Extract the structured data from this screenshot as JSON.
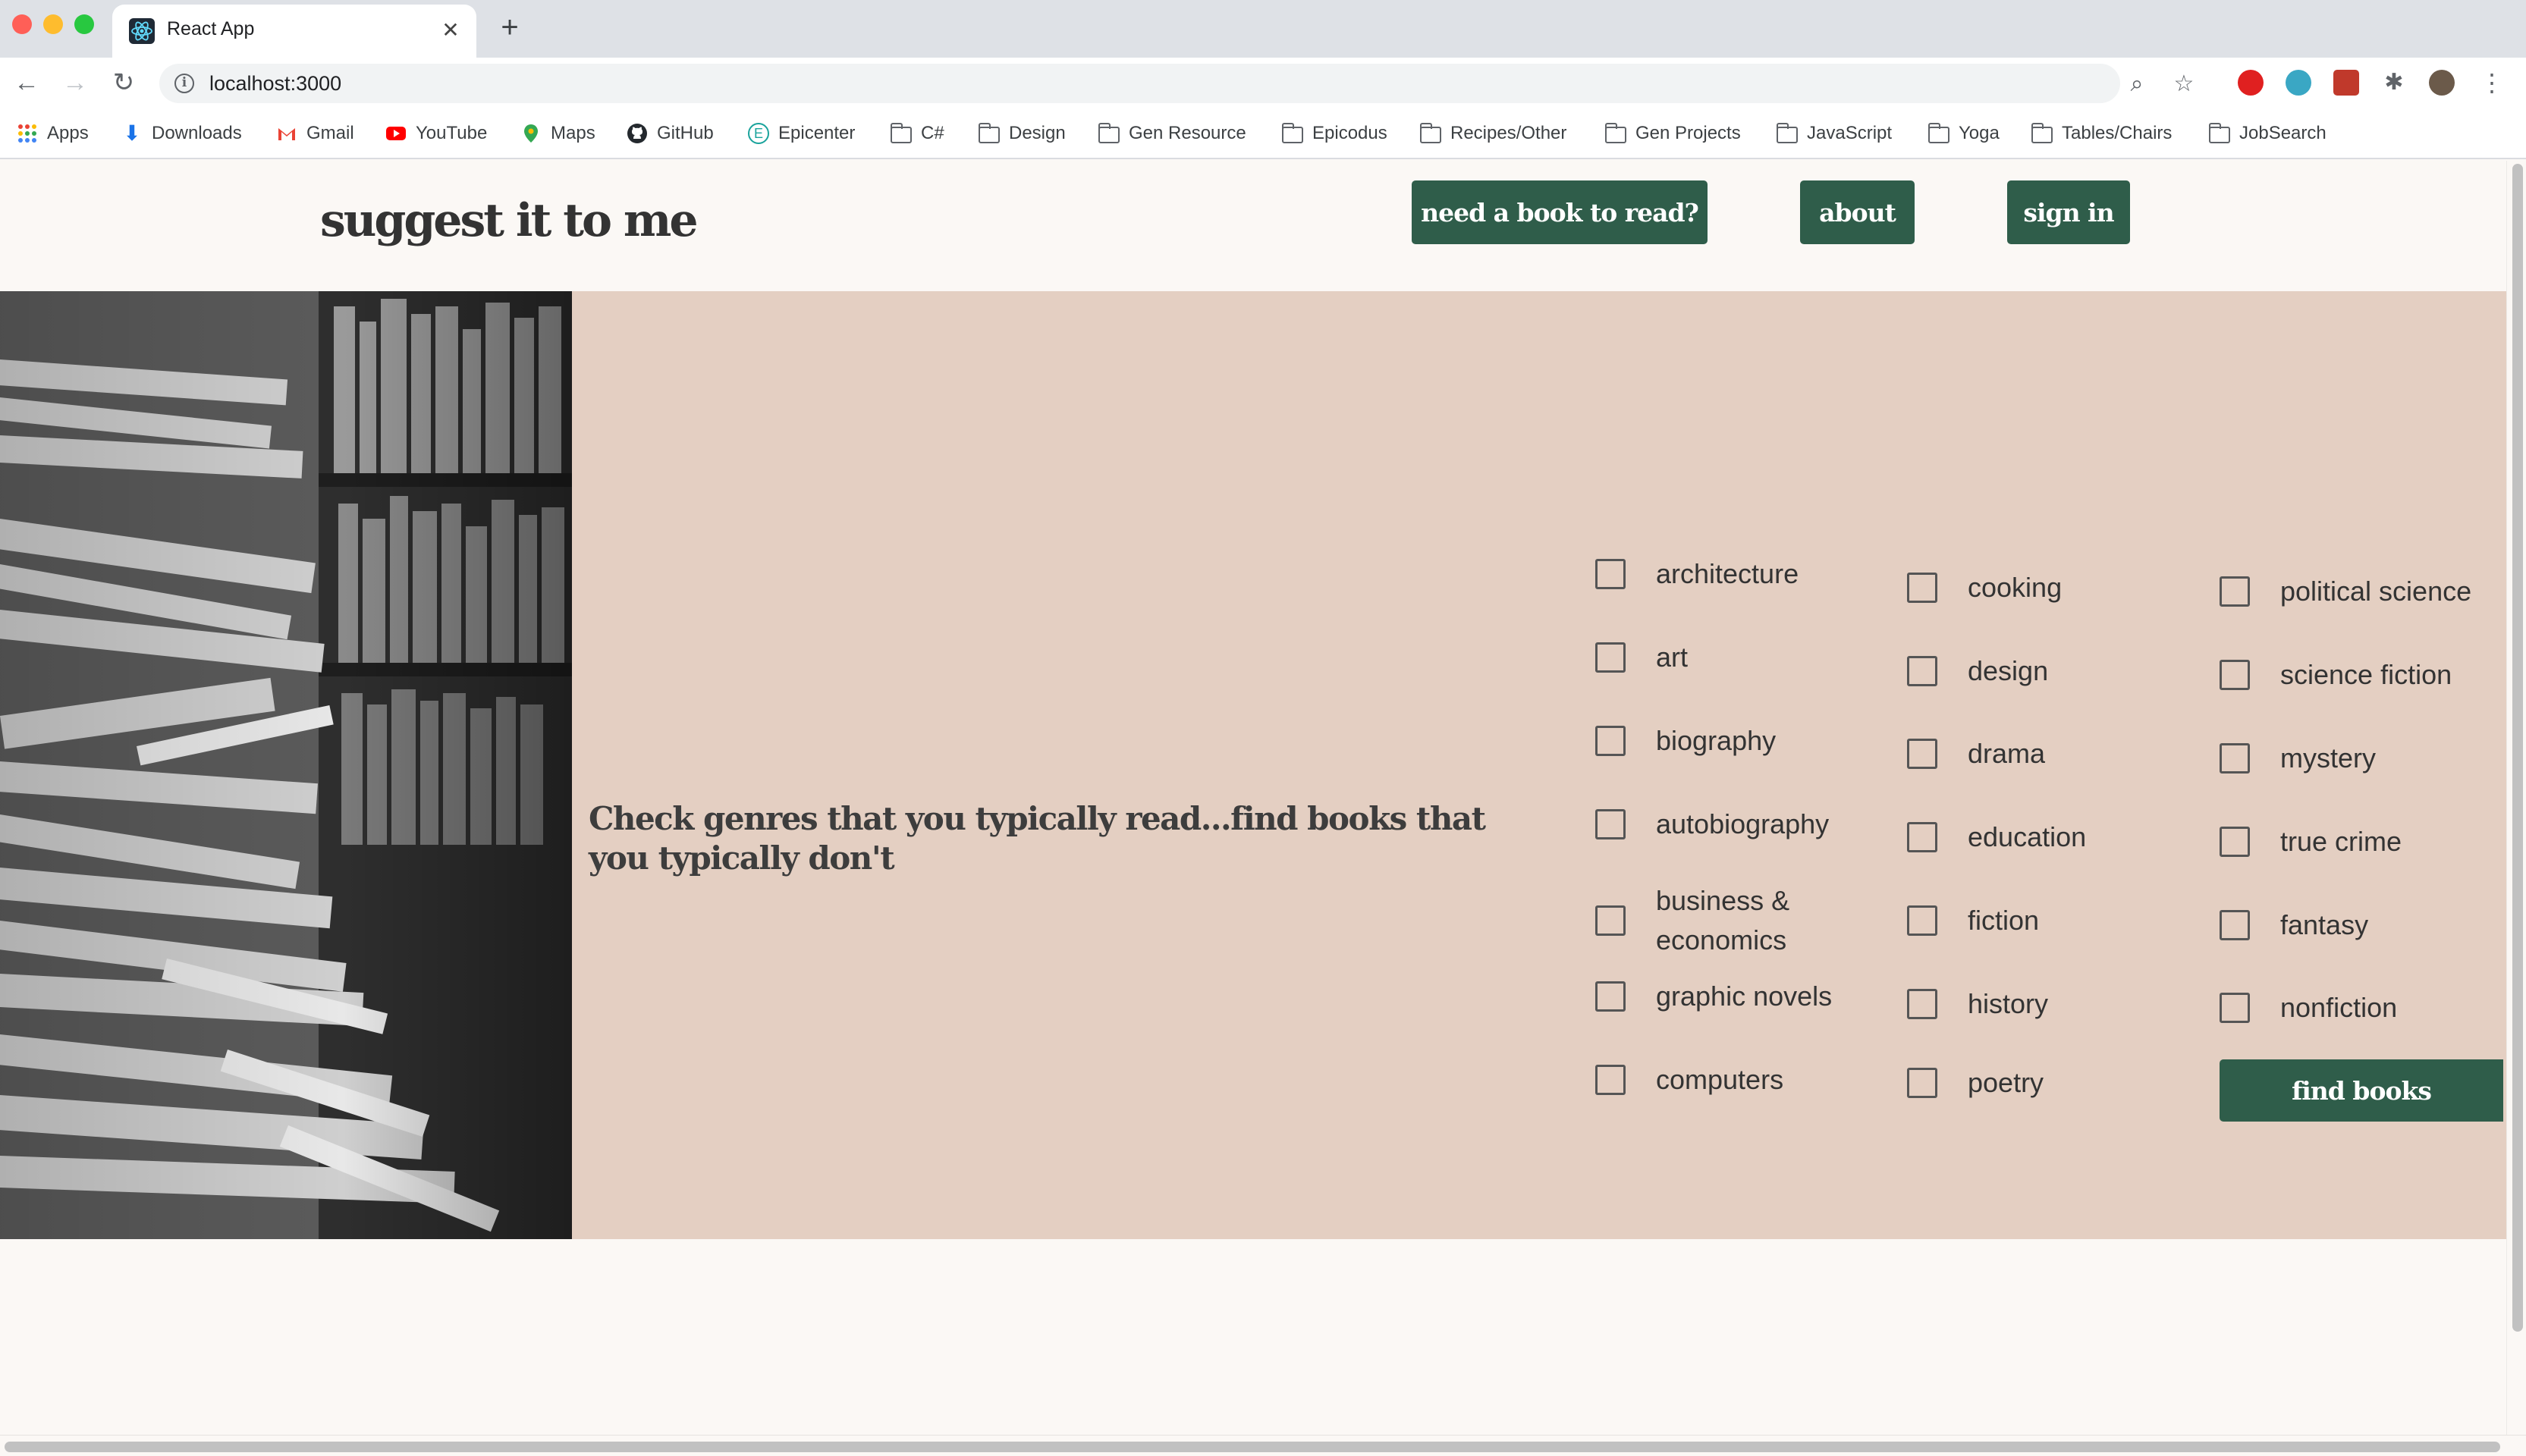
{
  "browser": {
    "tab_title": "React App",
    "tab_close": "✕",
    "new_tab": "+",
    "url": "localhost:3000",
    "nav": {
      "back": "←",
      "forward": "→",
      "reload": "↻"
    },
    "omnibox_icons": {
      "zoom": "⌕",
      "star": "☆"
    },
    "bookmarks": [
      {
        "label": "Apps",
        "icon": "apps-grid-icon"
      },
      {
        "label": "Downloads",
        "icon": "download-icon"
      },
      {
        "label": "Gmail",
        "icon": "gmail-icon"
      },
      {
        "label": "YouTube",
        "icon": "youtube-icon"
      },
      {
        "label": "Maps",
        "icon": "maps-pin-icon"
      },
      {
        "label": "GitHub",
        "icon": "github-icon"
      },
      {
        "label": "Epicenter",
        "icon": "epicenter-icon"
      },
      {
        "label": "C#",
        "icon": "folder-icon"
      },
      {
        "label": "Design",
        "icon": "folder-icon"
      },
      {
        "label": "Gen Resource",
        "icon": "folder-icon"
      },
      {
        "label": "Epicodus",
        "icon": "folder-icon"
      },
      {
        "label": "Recipes/Other",
        "icon": "folder-icon"
      },
      {
        "label": "Gen Projects",
        "icon": "folder-icon"
      },
      {
        "label": "JavaScript",
        "icon": "folder-icon"
      },
      {
        "label": "Yoga",
        "icon": "folder-icon"
      },
      {
        "label": "Tables/Chairs",
        "icon": "folder-icon"
      },
      {
        "label": "JobSearch",
        "icon": "folder-icon"
      }
    ]
  },
  "site": {
    "title": "suggest it to me",
    "nav": {
      "need_book": "need a book to read?",
      "about": "about",
      "sign_in": "sign in"
    },
    "tagline": "Check genres that you typically read...find books that you typically don't",
    "genres": {
      "col1": [
        "architecture",
        "art",
        "biography",
        "autobiography",
        "business & economics",
        "graphic novels",
        "computers"
      ],
      "col2": [
        "cooking",
        "design",
        "drama",
        "education",
        "fiction",
        "history",
        "poetry"
      ],
      "col3": [
        "political science",
        "science fiction",
        "mystery",
        "true crime",
        "fantasy",
        "nonfiction"
      ]
    },
    "find_button": "find books",
    "colors": {
      "accent_green": "#2f5d4a",
      "hero_bg": "#e4cfc2",
      "page_bg": "#fbf8f5"
    }
  }
}
